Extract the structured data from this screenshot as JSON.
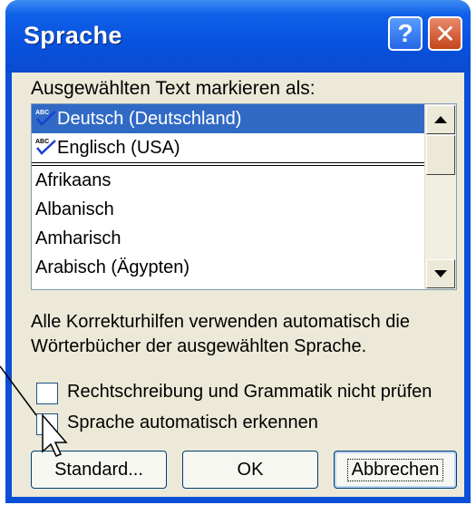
{
  "window": {
    "title": "Sprache",
    "help_label": "?",
    "close_label": "✕"
  },
  "list_label": "Ausgewählten Text markieren als:",
  "languages": [
    {
      "label": "Deutsch (Deutschland)",
      "spellcheck": true,
      "selected": true
    },
    {
      "label": "Englisch (USA)",
      "spellcheck": true,
      "selected": false
    },
    {
      "label": "Afrikaans",
      "spellcheck": false,
      "selected": false
    },
    {
      "label": "Albanisch",
      "spellcheck": false,
      "selected": false
    },
    {
      "label": "Amharisch",
      "spellcheck": false,
      "selected": false
    },
    {
      "label": "Arabisch (Ägypten)",
      "spellcheck": false,
      "selected": false
    }
  ],
  "info_text": "Alle Korrekturhilfen verwenden automatisch die Wörterbücher der ausgewählten Sprache.",
  "options": {
    "no_proofing": {
      "label": "Rechtschreibung und Grammatik nicht prüfen",
      "checked": false
    },
    "auto_detect": {
      "label": "Sprache automatisch erkennen",
      "checked": false
    }
  },
  "buttons": {
    "standard": "Standard...",
    "ok": "OK",
    "cancel": "Abbrechen"
  },
  "colors": {
    "titlebar": "#0852dd",
    "dialog_bg": "#ece9d8",
    "selection": "#316ac5"
  }
}
